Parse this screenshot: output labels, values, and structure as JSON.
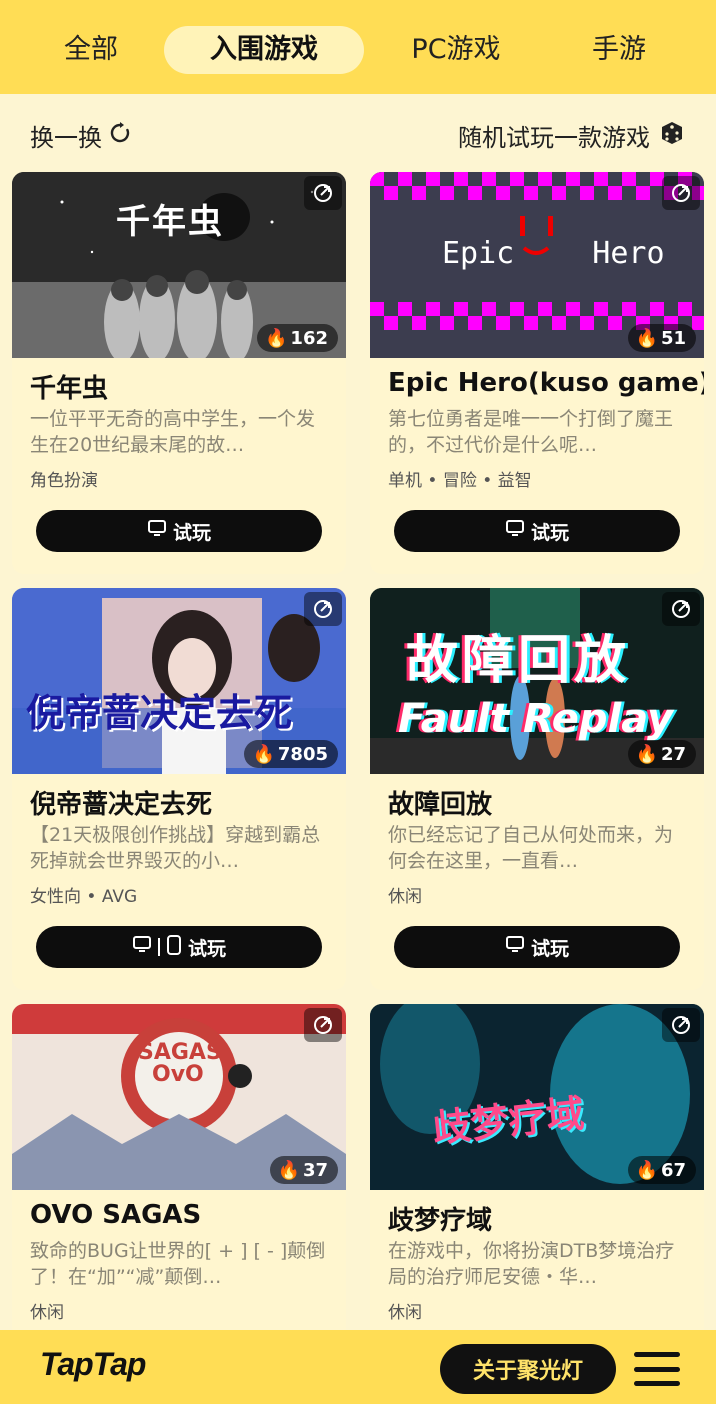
{
  "tabs": [
    {
      "label": "全部"
    },
    {
      "label": "入围游戏",
      "active": true
    },
    {
      "label": "PC游戏"
    },
    {
      "label": "手游"
    }
  ],
  "actions": {
    "refresh_label": "换一换",
    "random_label": "随机试玩一款游戏"
  },
  "cards": [
    {
      "title": "千年虫",
      "heat": "162",
      "desc": "一位平平无奇的高中学生，一个发生在20世纪最末尾的故…",
      "tags": "角色扮演",
      "play_label": "试玩",
      "thumb_text": "千年虫"
    },
    {
      "title": "Epic Hero(kuso game)",
      "heat": "51",
      "desc": "第七位勇者是唯一一个打倒了魔王的，不过代价是什么呢…",
      "tags": "单机 • 冒险 • 益智",
      "play_label": "试玩",
      "thumb_text": "Epic Hero"
    },
    {
      "title": "倪帝蔷决定去死",
      "heat": "7805",
      "desc": "【21天极限创作挑战】穿越到霸总死掉就会世界毁灭的小…",
      "tags": "女性向 • AVG",
      "play_label": "试玩",
      "thumb_text": "倪帝蔷决定去死"
    },
    {
      "title": "故障回放",
      "heat": "27",
      "desc": "你已经忘记了自己从何处而来，为何会在这里，一直看…",
      "tags": "休闲",
      "play_label": "试玩",
      "thumb_text": "故障回放",
      "thumb_text2": "Fault Replay"
    },
    {
      "title": "OVO SAGAS",
      "heat": "37",
      "desc": "致命的BUG让世界的[ + ] [ - ]颠倒了！在“加”“减”颠倒…",
      "tags": "休闲",
      "thumb_text": "SAGAS"
    },
    {
      "title": "歧梦疗域",
      "heat": "67",
      "desc": "在游戏中，你将扮演DTB梦境治疗局的治疗师尼安德・华…",
      "tags": "休闲",
      "thumb_text": "歧梦疗域"
    }
  ],
  "bottom": {
    "logo": "TapTap",
    "about_label": "关于聚光灯"
  },
  "colors": {
    "accent": "#FFDD55",
    "background": "#FDF5D2",
    "card": "#FFF6CF",
    "button": "#0d0d0d"
  }
}
